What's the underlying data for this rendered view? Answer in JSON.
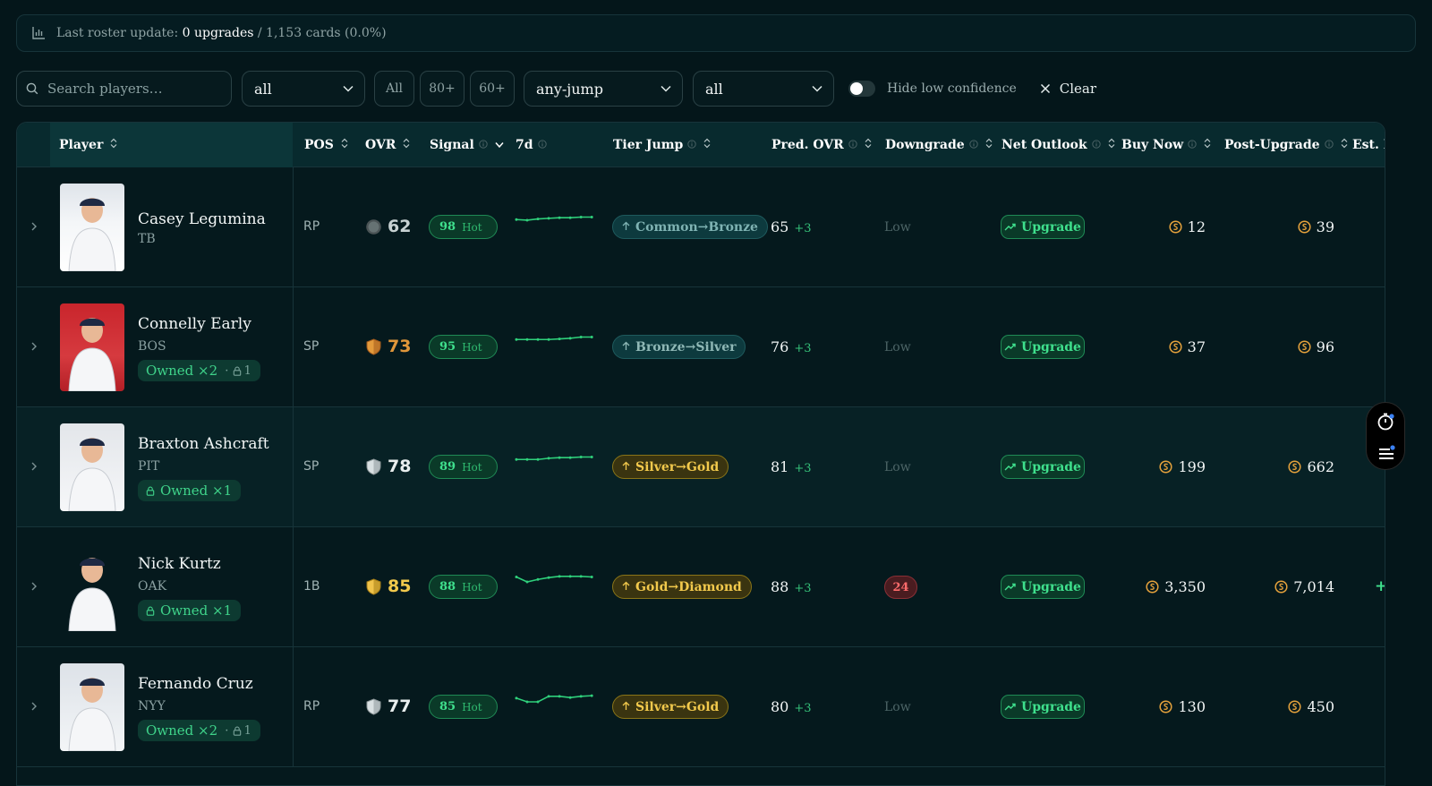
{
  "banner": {
    "prefix": "Last roster update:",
    "upgrades": "0 upgrades",
    "suffix": " / 1,153 cards (0.0%)"
  },
  "filters": {
    "search_placeholder": "Search players…",
    "select1": "all",
    "pills": [
      "All",
      "80+",
      "60+"
    ],
    "jump_select": "any-jump",
    "select3": "all",
    "hide_low_confidence": "Hide low confidence",
    "clear": "Clear"
  },
  "columns": {
    "player": "Player",
    "pos": "POS",
    "ovr": "OVR",
    "signal": "Signal",
    "d7": "7d",
    "tier_jump": "Tier Jump",
    "pred_ovr": "Pred. OVR",
    "downgrade": "Downgrade",
    "net_outlook": "Net Outlook",
    "buy_now": "Buy Now",
    "post_upgrade": "Post-Upgrade",
    "est": "Est. Pr"
  },
  "colors": {
    "accent_green": "#3fe08d",
    "gold": "#f2c94c",
    "bronze": "#e0963a",
    "danger": "#ff6b6b",
    "background": "#04161a"
  },
  "rows": [
    {
      "name": "Casey Legumina",
      "team": "TB",
      "owned": null,
      "lock": null,
      "pos": "RP",
      "ovr": "62",
      "ovr_tier": "common",
      "signal": "98",
      "signal_label": "Hot",
      "spark": [
        0.3,
        0.35,
        0.25,
        0.2,
        0.15,
        0.15,
        0.1,
        0.1
      ],
      "tier_jump": "Common→Bronze",
      "tier_style": "common",
      "pred": "65",
      "pred_delta": "+3",
      "downgrade": "Low",
      "downgrade_alert": false,
      "outlook": "Upgrade",
      "buy": "12",
      "post": "39",
      "est": ""
    },
    {
      "name": "Connelly Early",
      "team": "BOS",
      "owned": "Owned ×2",
      "lock": "1",
      "pos": "SP",
      "ovr": "73",
      "ovr_tier": "bronze",
      "signal": "95",
      "signal_label": "Hot",
      "spark": [
        0.3,
        0.3,
        0.3,
        0.3,
        0.25,
        0.2,
        0.1,
        0.1
      ],
      "tier_jump": "Bronze→Silver",
      "tier_style": "bronze",
      "pred": "76",
      "pred_delta": "+3",
      "downgrade": "Low",
      "downgrade_alert": false,
      "outlook": "Upgrade",
      "buy": "37",
      "post": "96",
      "est": ""
    },
    {
      "name": "Braxton Ashcraft",
      "team": "PIT",
      "owned": "Owned ×1",
      "lock": null,
      "pos": "SP",
      "ovr": "78",
      "ovr_tier": "silver",
      "signal": "89",
      "signal_label": "Hot",
      "spark": [
        0.3,
        0.3,
        0.3,
        0.2,
        0.15,
        0.15,
        0.1,
        0.1
      ],
      "tier_jump": "Silver→Gold",
      "tier_style": "gold",
      "pred": "81",
      "pred_delta": "+3",
      "downgrade": "Low",
      "downgrade_alert": false,
      "outlook": "Upgrade",
      "buy": "199",
      "post": "662",
      "est": ""
    },
    {
      "name": "Nick Kurtz",
      "team": "OAK",
      "owned": "Owned ×1",
      "lock": null,
      "pos": "1B",
      "ovr": "85",
      "ovr_tier": "gold",
      "signal": "88",
      "signal_label": "Hot",
      "spark": [
        0.1,
        0.5,
        0.3,
        0.15,
        0.05,
        0.05,
        0.05,
        0.1
      ],
      "tier_jump": "Gold→Diamond",
      "tier_style": "gold",
      "pred": "88",
      "pred_delta": "+3",
      "downgrade": "24",
      "downgrade_alert": true,
      "outlook": "Upgrade",
      "buy": "3,350",
      "post": "7,014",
      "est": "+"
    },
    {
      "name": "Fernando Cruz",
      "team": "NYY",
      "owned": "Owned ×2",
      "lock": "1",
      "pos": "RP",
      "ovr": "77",
      "ovr_tier": "silver",
      "signal": "85",
      "signal_label": "Hot",
      "spark": [
        0.2,
        0.5,
        0.5,
        0.05,
        0.05,
        0.15,
        0.05,
        0.0
      ],
      "tier_jump": "Silver→Gold",
      "tier_style": "gold",
      "pred": "80",
      "pred_delta": "+3",
      "downgrade": "Low",
      "downgrade_alert": false,
      "outlook": "Upgrade",
      "buy": "130",
      "post": "450",
      "est": ""
    }
  ]
}
